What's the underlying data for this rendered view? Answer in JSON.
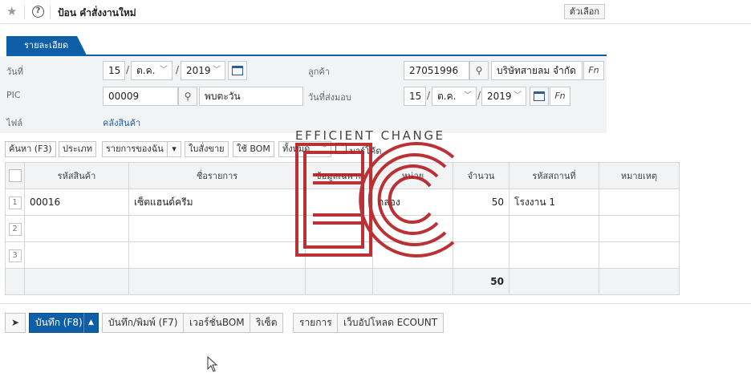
{
  "header": {
    "title": "ป้อน คำสั่งงานใหม่",
    "options_label": "ตัวเลือก"
  },
  "tab": {
    "label": "รายละเอียด"
  },
  "form": {
    "date": {
      "label": "วันที่",
      "day": "15",
      "month": "ต.ค.",
      "year": "2019"
    },
    "customer": {
      "label": "ลูกค้า",
      "code": "27051996",
      "name": "บริษัทสายลม จำกัด"
    },
    "pic": {
      "label": "PIC",
      "code": "00009",
      "name": "พบตะวัน"
    },
    "delivery_date": {
      "label": "วันที่ส่งมอบ",
      "day": "15",
      "month": "ต.ค.",
      "year": "2019"
    },
    "file": {
      "label": "ไฟล์",
      "link": "คลังสินค้า"
    },
    "fn_label": "Fn",
    "date_separator": "/"
  },
  "toolbar": {
    "search": "ค้นหา (F3)",
    "type": "ประเภท",
    "my_list": "รายการของฉัน",
    "sales_slip": "ใบสั่งขาย",
    "use_bom": "ใช้ BOM",
    "filter": "ทั้งหมด",
    "barcode": "บาร์โค้ด"
  },
  "table": {
    "columns": [
      "รหัสสินค้า",
      "ชื่อรายการ",
      "ข้อมูลเฉพาะ",
      "หน่วย",
      "จำนวน",
      "รหัสสถานที่",
      "หมายเหตุ"
    ],
    "rows": [
      {
        "no": "1",
        "code": "00016",
        "name": "เซ็ตแฮนด์ครีม",
        "spec": "",
        "unit": "กล่อง",
        "qty": "50",
        "location": "โรงงาน 1",
        "note": ""
      },
      {
        "no": "2",
        "code": "",
        "name": "",
        "spec": "",
        "unit": "",
        "qty": "",
        "location": "",
        "note": ""
      },
      {
        "no": "3",
        "code": "",
        "name": "",
        "spec": "",
        "unit": "",
        "qty": "",
        "location": "",
        "note": ""
      }
    ],
    "total_qty": "50"
  },
  "bottom": {
    "save": "บันทึก (F8)",
    "save_print": "บันทึก/พิมพ์ (F7)",
    "version_bom": "เวอร์ชั่นBOM",
    "reset": "ริเซ็ต",
    "list": "รายการ",
    "web_upload": "เว็บอัปโหลด ECOUNT"
  },
  "watermark": {
    "text": "EFFICIENT CHANGE"
  },
  "colors": {
    "primary": "#0e5fa8",
    "watermark_red": "#b52025",
    "panel_bg": "#f2f3f5"
  }
}
